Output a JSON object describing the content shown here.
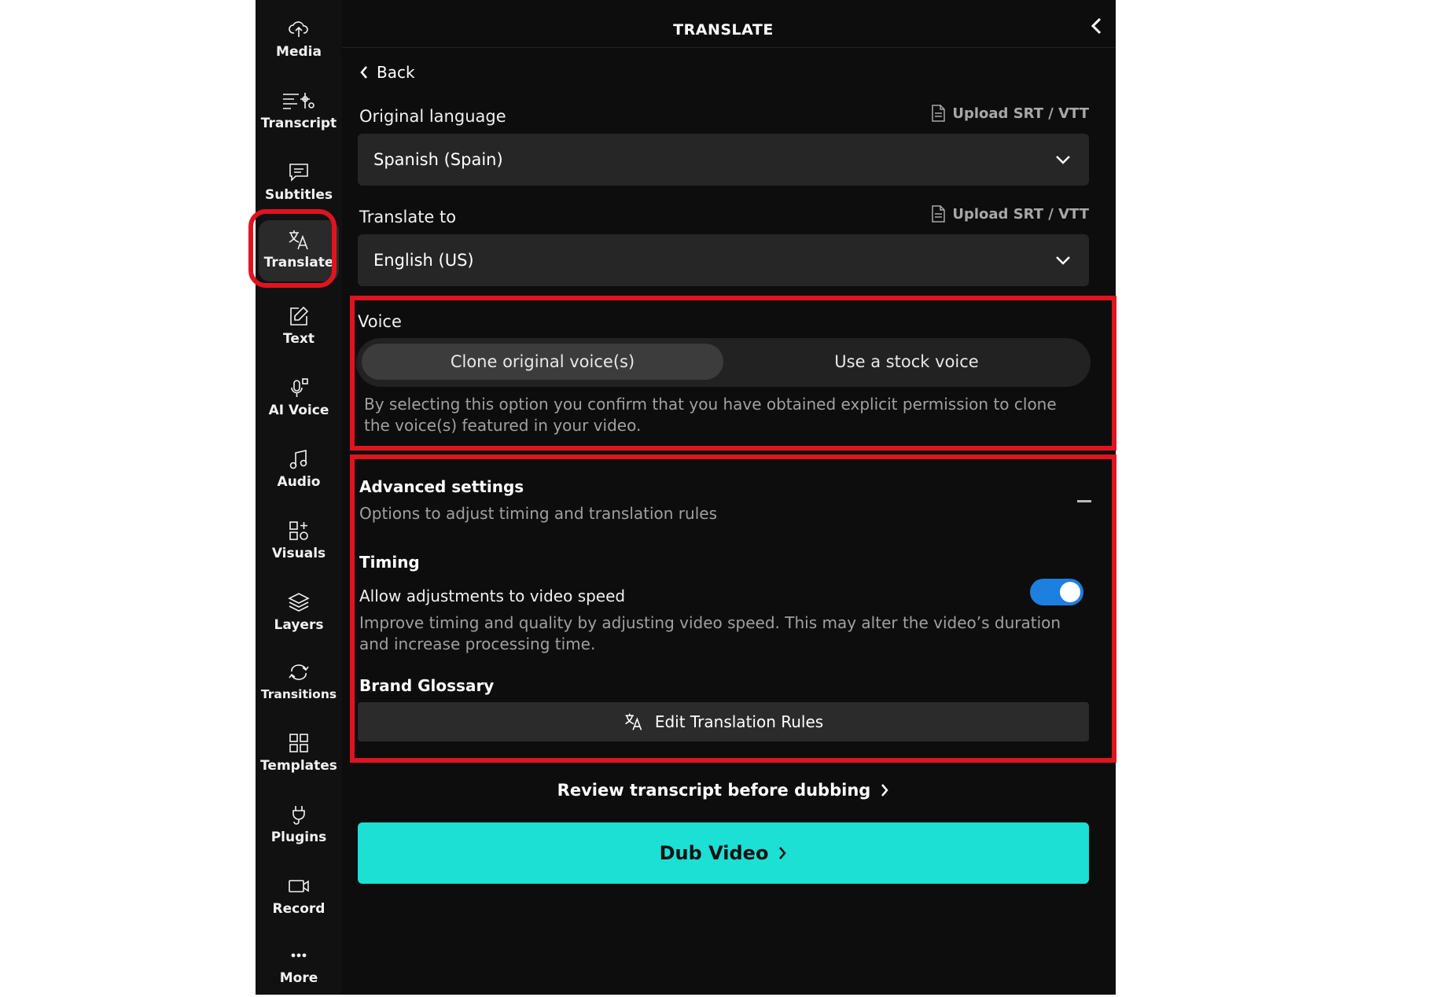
{
  "sidebar": {
    "items": [
      {
        "label": "Media",
        "icon": "upload-cloud-icon"
      },
      {
        "label": "Transcript",
        "icon": "transcript-icon"
      },
      {
        "label": "Subtitles",
        "icon": "subtitles-icon"
      },
      {
        "label": "Translate",
        "icon": "translate-icon",
        "active": true
      },
      {
        "label": "Text",
        "icon": "edit-text-icon"
      },
      {
        "label": "AI Voice",
        "icon": "microphone-icon"
      },
      {
        "label": "Audio",
        "icon": "music-note-icon"
      },
      {
        "label": "Visuals",
        "icon": "visuals-icon"
      },
      {
        "label": "Layers",
        "icon": "layers-icon"
      },
      {
        "label": "Transitions",
        "icon": "transitions-icon"
      },
      {
        "label": "Templates",
        "icon": "templates-icon"
      },
      {
        "label": "Plugins",
        "icon": "plug-icon"
      },
      {
        "label": "Record",
        "icon": "video-camera-icon"
      },
      {
        "label": "More",
        "icon": "more-dots-icon"
      }
    ]
  },
  "header": {
    "title": "TRANSLATE"
  },
  "back_label": "Back",
  "original_language": {
    "label": "Original language",
    "upload": "Upload SRT / VTT",
    "value": "Spanish (Spain)"
  },
  "translate_to": {
    "label": "Translate to",
    "upload": "Upload SRT / VTT",
    "value": "English (US)"
  },
  "voice": {
    "label": "Voice",
    "option_clone": "Clone original voice(s)",
    "option_stock": "Use a stock voice",
    "selected": "clone",
    "note": "By selecting this option you confirm that you have obtained explicit permission to clone the voice(s) featured in your video."
  },
  "advanced": {
    "title": "Advanced settings",
    "subtitle": "Options to adjust timing and translation rules",
    "timing_title": "Timing",
    "speed_label": "Allow adjustments to video speed",
    "speed_enabled": true,
    "speed_desc": "Improve timing and quality by adjusting video speed. This may alter the video’s duration and increase processing time.",
    "glossary_title": "Brand Glossary",
    "edit_rules": "Edit Translation Rules"
  },
  "review_label": "Review transcript before dubbing",
  "dub_label": "Dub Video",
  "colors": {
    "accent": "#1ce0d4",
    "toggle": "#1d7fe0",
    "highlight": "#e0141f"
  }
}
